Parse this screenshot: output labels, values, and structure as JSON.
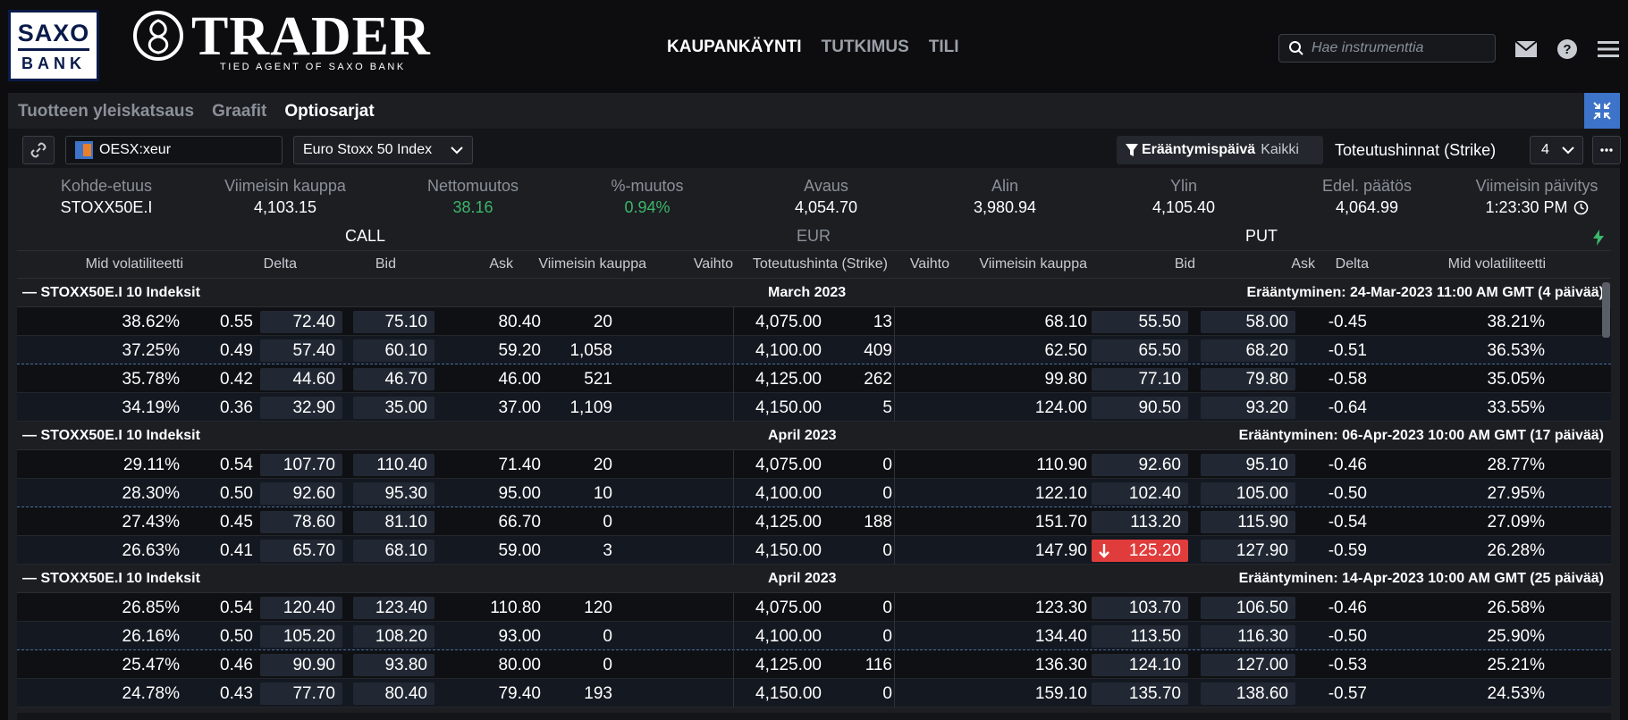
{
  "brand": {
    "saxo_line1": "SAXO",
    "saxo_line2": "BANK",
    "trader_word": "TRADER",
    "trader_tagline": "TIED AGENT OF SAXO BANK"
  },
  "nav": [
    "KAUPANKÄYNTI",
    "TUTKIMUS",
    "TILI"
  ],
  "search": {
    "placeholder": "Hae instrumenttia"
  },
  "tabs": [
    "Tuotteen yleiskatsaus",
    "Graafit",
    "Optiosarjat"
  ],
  "toolbar": {
    "instrument": "OESX:xeur",
    "underlying": "Euro Stoxx 50 Index",
    "expiry_label": "Erääntymispäivä",
    "expiry_value": "Kaikki",
    "strikes_label": "Toteutushinnat (Strike)",
    "strikes_count": "4"
  },
  "info": {
    "labels": [
      "Kohde-etuus",
      "Viimeisin kauppa",
      "Nettomuutos",
      "%-muutos",
      "Avaus",
      "Alin",
      "Ylin",
      "Edel. päätös",
      "Viimeisin päivitys"
    ],
    "values": [
      "STOXX50E.I",
      "4,103.15",
      "38.16",
      "0.94%",
      "4,054.70",
      "3,980.94",
      "4,105.40",
      "4,064.99",
      "1:23:30 PM"
    ]
  },
  "table": {
    "side_call": "CALL",
    "side_mid": "EUR",
    "side_put": "PUT",
    "columns": [
      "Mid volatiliteetti",
      "Delta",
      "Bid",
      "Ask",
      "Viimeisin kauppa",
      "Vaihto",
      "Toteutushinta (Strike)",
      "Vaihto",
      "Viimeisin kauppa",
      "Bid",
      "Ask",
      "Delta",
      "Mid volatiliteetti"
    ],
    "groups": [
      {
        "underlying": "STOXX50E.I 10 Indeksit",
        "month": "March 2023",
        "expiry": "Erääntyminen: 24-Mar-2023 11:00 AM GMT (4 päivää)",
        "rows": [
          [
            "38.62%",
            "0.55",
            "72.40",
            "75.10",
            "80.40",
            "20",
            "4,075.00",
            "13",
            "68.10",
            "55.50",
            "58.00",
            "-0.45",
            "38.21%"
          ],
          [
            "37.25%",
            "0.49",
            "57.40",
            "60.10",
            "59.20",
            "1,058",
            "4,100.00",
            "409",
            "62.50",
            "65.50",
            "68.20",
            "-0.51",
            "36.53%"
          ],
          [
            "35.78%",
            "0.42",
            "44.60",
            "46.70",
            "46.00",
            "521",
            "4,125.00",
            "262",
            "99.80",
            "77.10",
            "79.80",
            "-0.58",
            "35.05%"
          ],
          [
            "34.19%",
            "0.36",
            "32.90",
            "35.00",
            "37.00",
            "1,109",
            "4,150.00",
            "5",
            "124.00",
            "90.50",
            "93.20",
            "-0.64",
            "33.55%"
          ]
        ]
      },
      {
        "underlying": "STOXX50E.I 10 Indeksit",
        "month": "April 2023",
        "expiry": "Erääntyminen: 06-Apr-2023 10:00 AM GMT (17 päivää)",
        "rows": [
          [
            "29.11%",
            "0.54",
            "107.70",
            "110.40",
            "71.40",
            "20",
            "4,075.00",
            "0",
            "110.90",
            "92.60",
            "95.10",
            "-0.46",
            "28.77%"
          ],
          [
            "28.30%",
            "0.50",
            "92.60",
            "95.30",
            "95.00",
            "10",
            "4,100.00",
            "0",
            "122.10",
            "102.40",
            "105.00",
            "-0.50",
            "27.95%"
          ],
          [
            "27.43%",
            "0.45",
            "78.60",
            "81.10",
            "66.70",
            "0",
            "4,125.00",
            "188",
            "151.70",
            "113.20",
            "115.90",
            "-0.54",
            "27.09%"
          ],
          [
            "26.63%",
            "0.41",
            "65.70",
            "68.10",
            "59.00",
            "3",
            "4,150.00",
            "0",
            "147.90",
            "125.20",
            "127.90",
            "-0.59",
            "26.28%"
          ]
        ]
      },
      {
        "underlying": "STOXX50E.I 10 Indeksit",
        "month": "April 2023",
        "expiry": "Erääntyminen: 14-Apr-2023 10:00 AM GMT (25 päivää)",
        "rows": [
          [
            "26.85%",
            "0.54",
            "120.40",
            "123.40",
            "110.80",
            "120",
            "4,075.00",
            "0",
            "123.30",
            "103.70",
            "106.50",
            "-0.46",
            "26.58%"
          ],
          [
            "26.16%",
            "0.50",
            "105.20",
            "108.20",
            "93.00",
            "0",
            "4,100.00",
            "0",
            "134.40",
            "113.50",
            "116.30",
            "-0.50",
            "25.90%"
          ],
          [
            "25.47%",
            "0.46",
            "90.90",
            "93.80",
            "80.00",
            "0",
            "4,125.00",
            "116",
            "136.30",
            "124.10",
            "127.00",
            "-0.53",
            "25.21%"
          ],
          [
            "24.78%",
            "0.43",
            "77.70",
            "80.40",
            "79.40",
            "193",
            "4,150.00",
            "0",
            "159.10",
            "135.70",
            "138.60",
            "-0.57",
            "24.53%"
          ]
        ]
      }
    ]
  },
  "colors": {
    "accent": "#3d73c9",
    "positive": "#3cb66a",
    "negative": "#e03c3c"
  }
}
